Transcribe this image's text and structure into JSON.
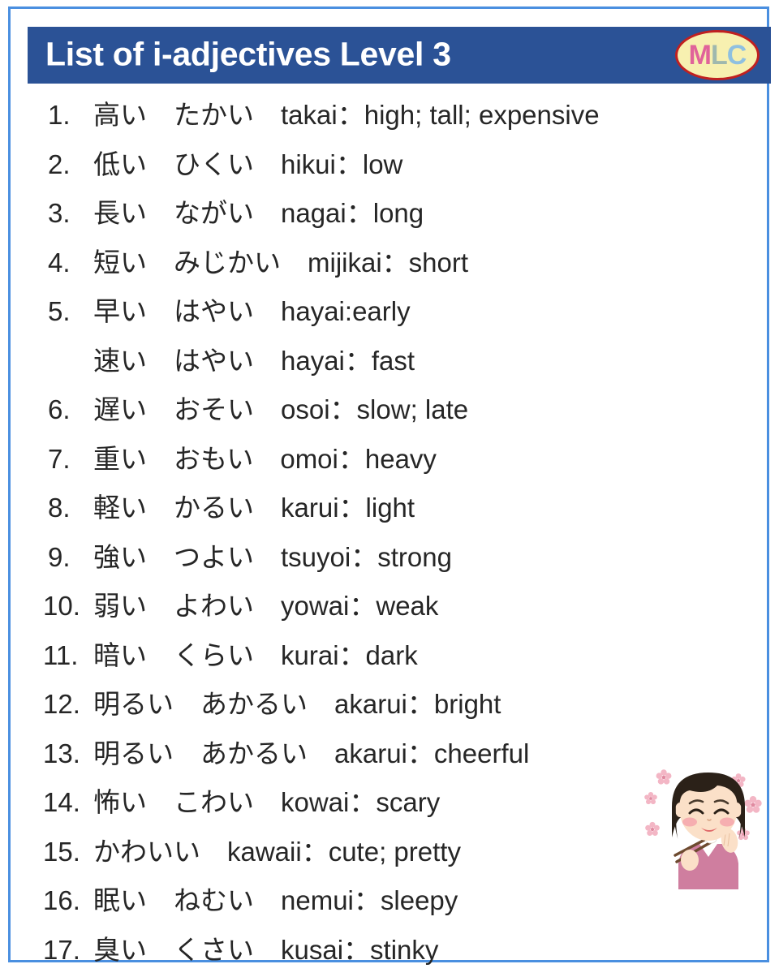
{
  "header": {
    "title": "List of i-adjectives Level 3",
    "logo": {
      "m": "M",
      "l": "L",
      "c": "C",
      "ellipse_fill": "#f7f0b0",
      "ellipse_border": "#c02020",
      "m_color": "#e0639a",
      "l_color": "#9fb8ae",
      "c_color": "#8fc0e0"
    },
    "bar_color": "#2b5296",
    "text_color": "#ffffff"
  },
  "frame": {
    "border_color": "#4a8fe0",
    "background": "#ffffff"
  },
  "list": [
    {
      "num": "1.",
      "kanji": "高い",
      "kana": "たかい",
      "romaji": "takai",
      "sep": "：",
      "meaning": "high; tall; expensive"
    },
    {
      "num": "2.",
      "kanji": "低い",
      "kana": "ひくい",
      "romaji": "hikui",
      "sep": "：",
      "meaning": "low"
    },
    {
      "num": "3.",
      "kanji": "長い",
      "kana": "ながい",
      "romaji": "nagai",
      "sep": "：",
      "meaning": "long"
    },
    {
      "num": "4.",
      "kanji": "短い",
      "kana": "みじかい",
      "romaji": "mijikai",
      "sep": "：",
      "meaning": "short"
    },
    {
      "num": "5.",
      "kanji": "早い",
      "kana": "はやい",
      "romaji": "hayai",
      "sep": ": ",
      "meaning": "early"
    },
    {
      "num": "",
      "kanji": "速い",
      "kana": "はやい",
      "romaji": "hayai",
      "sep": "：",
      "meaning": "fast"
    },
    {
      "num": "6.",
      "kanji": "遅い",
      "kana": "おそい",
      "romaji": "osoi",
      "sep": "：",
      "meaning": "slow; late"
    },
    {
      "num": "7.",
      "kanji": "重い",
      "kana": "おもい",
      "romaji": "omoi",
      "sep": "：",
      "meaning": "heavy"
    },
    {
      "num": "8.",
      "kanji": "軽い",
      "kana": "かるい",
      "romaji": "karui",
      "sep": "：",
      "meaning": "light"
    },
    {
      "num": "9.",
      "kanji": "強い",
      "kana": "つよい",
      "romaji": "tsuyoi",
      "sep": "：",
      "meaning": "strong"
    },
    {
      "num": "10.",
      "kanji": "弱い",
      "kana": "よわい",
      "romaji": "yowai",
      "sep": "：",
      "meaning": "weak"
    },
    {
      "num": "11.",
      "kanji": "暗い",
      "kana": "くらい",
      "romaji": "kurai",
      "sep": "：",
      "meaning": "dark"
    },
    {
      "num": "12.",
      "kanji": "明るい",
      "kana": "あかるい",
      "romaji": "akarui",
      "sep": "：",
      "meaning": "bright"
    },
    {
      "num": "13.",
      "kanji": "明るい",
      "kana": "あかるい",
      "romaji": "akarui",
      "sep": "：",
      "meaning": "cheerful"
    },
    {
      "num": "14.",
      "kanji": "怖い",
      "kana": "こわい",
      "romaji": "kowai",
      "sep": "：",
      "meaning": "scary"
    },
    {
      "num": "15.",
      "kanji": "",
      "kana": "かわいい",
      "romaji": "kawaii",
      "sep": "：",
      "meaning": "cute; pretty"
    },
    {
      "num": "16.",
      "kanji": "眠い",
      "kana": "ねむい",
      "romaji": "nemui",
      "sep": "：",
      "meaning": "sleepy"
    },
    {
      "num": "17.",
      "kanji": "臭い",
      "kana": "くさい",
      "romaji": "kusai",
      "sep": "：",
      "meaning": "stinky"
    }
  ],
  "illustration": {
    "description": "woman-eating-happily",
    "hair_color": "#2b2118",
    "skin_color": "#fbe0c8",
    "blush_color": "#f6aeb0",
    "sweater_color": "#cf7e9f",
    "collar_color": "#ffffff",
    "chopsticks_color": "#6d4a2f",
    "flower_petal_color": "#f3b6c5",
    "flower_center_color": "#e08aa0"
  }
}
